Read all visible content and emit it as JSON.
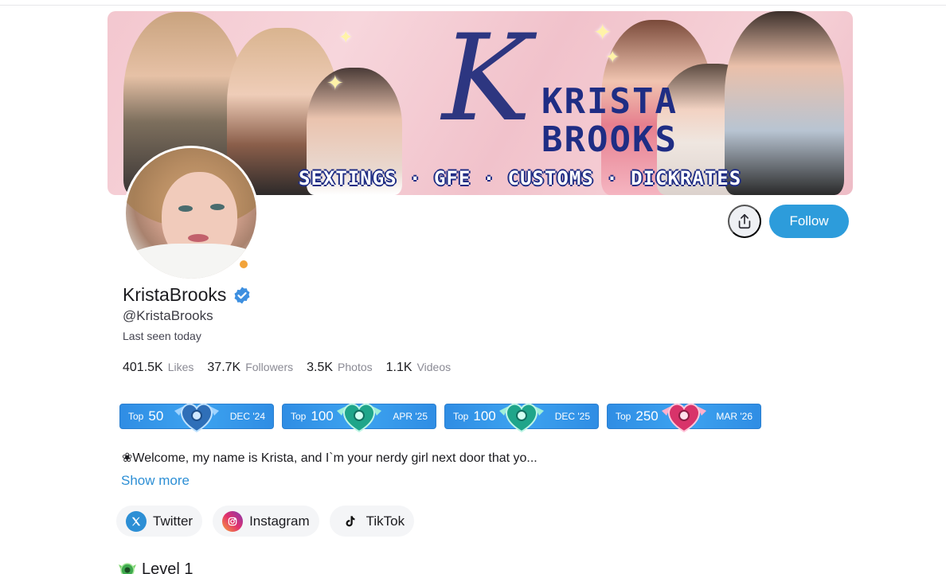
{
  "banner": {
    "title_line1": "KRISTA",
    "title_line2": "BROOKS",
    "script_letter": "K",
    "tagline": "SEXTINGS · GFE · CUSTOMS · DICKRATES"
  },
  "profile": {
    "display_name": "KristaBrooks",
    "handle": "@KristaBrooks",
    "last_seen": "Last seen today",
    "online_status_color": "#f2a33a"
  },
  "actions": {
    "follow_label": "Follow",
    "share_icon": "share-icon"
  },
  "stats": [
    {
      "value": "401.5K",
      "label": "Likes"
    },
    {
      "value": "37.7K",
      "label": "Followers"
    },
    {
      "value": "3.5K",
      "label": "Photos"
    },
    {
      "value": "1.1K",
      "label": "Videos"
    }
  ],
  "badges": [
    {
      "top_label": "Top",
      "rank": "50",
      "date": "DEC '24",
      "heart_color": "#2f6fb8"
    },
    {
      "top_label": "Top",
      "rank": "100",
      "date": "APR '25",
      "heart_color": "#1fa58a"
    },
    {
      "top_label": "Top",
      "rank": "100",
      "date": "DEC '25",
      "heart_color": "#1fa58a"
    },
    {
      "top_label": "Top",
      "rank": "250",
      "date": "MAR '26",
      "heart_color": "#d8336a"
    }
  ],
  "bio": {
    "text": "❀Welcome, my name is Krista, and I`m your nerdy girl next door that yo...",
    "show_more_label": "Show more"
  },
  "socials": [
    {
      "label": "Twitter",
      "icon": "x-twitter-icon"
    },
    {
      "label": "Instagram",
      "icon": "instagram-icon"
    },
    {
      "label": "TikTok",
      "icon": "tiktok-icon"
    }
  ],
  "level": {
    "label": "Level 1",
    "icon": "level-badge-icon"
  },
  "colors": {
    "accent": "#2d9cdb",
    "badge_blue": "#2f8de4",
    "link": "#2d8fd5"
  }
}
